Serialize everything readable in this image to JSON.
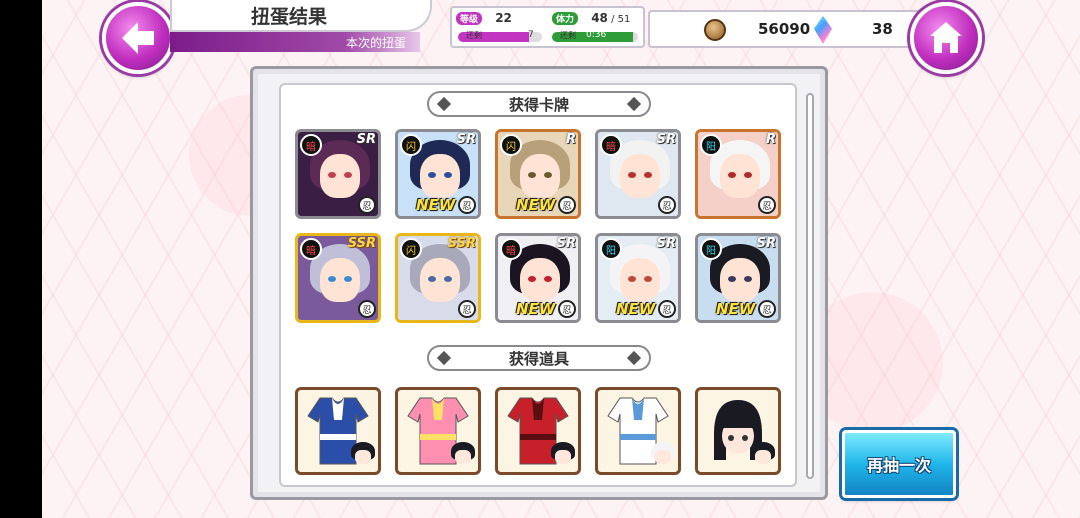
{
  "header": {
    "title": "扭蛋结果",
    "subtitle": "本次的扭蛋",
    "back_icon": "arrow-left-icon",
    "home_icon": "home-icon"
  },
  "status": {
    "level_label": "等级",
    "level_value": "22",
    "level_remain_label": "还剩",
    "level_remain_value": "7",
    "level_progress": 0.85,
    "stamina_label": "体力",
    "stamina_value": "48",
    "stamina_max": "/ 51",
    "stamina_remain_label": "还剩",
    "stamina_remain_value": "0:36",
    "stamina_progress": 0.94,
    "coins": "56090",
    "gems": "38",
    "level_color": "#c235c0",
    "stamina_color": "#2f9c3a"
  },
  "cards_section": {
    "title": "获得卡牌",
    "cards": [
      {
        "rarity": "SR",
        "type": "暗",
        "type_color": "red",
        "new": "",
        "hair": "#5b2a55",
        "eye": "#c04050",
        "bg": "#3a1e44",
        "frame": "#8d8b92"
      },
      {
        "rarity": "SR",
        "type": "闪",
        "type_color": "yellow",
        "new": "NEW",
        "hair": "#1e2a55",
        "eye": "#2c4fa0",
        "bg": "#c8e0f8",
        "frame": "#8d8b92"
      },
      {
        "rarity": "R",
        "type": "闪",
        "type_color": "yellow",
        "new": "NEW",
        "hair": "#b8a07a",
        "eye": "#6a5a30",
        "bg": "#e8d6b8",
        "frame": "#c8742e"
      },
      {
        "rarity": "SR",
        "type": "暗",
        "type_color": "red",
        "new": "",
        "hair": "#f2f2f2",
        "eye": "#b83030",
        "bg": "#dfe8f0",
        "frame": "#8d8b92"
      },
      {
        "rarity": "R",
        "type": "阳",
        "type_color": "cyan",
        "new": "",
        "hair": "#f5f5f5",
        "eye": "#b02a2a",
        "bg": "#f4d0c8",
        "frame": "#c8742e"
      },
      {
        "rarity": "SSR",
        "type": "暗",
        "type_color": "red",
        "new": "",
        "hair": "#bfc0d8",
        "eye": "#3a8ad0",
        "bg": "#7a5a9a",
        "frame": "#e8b81a"
      },
      {
        "rarity": "SSR",
        "type": "闪",
        "type_color": "yellow",
        "new": "",
        "hair": "#a9a9bc",
        "eye": "#4a6aa0",
        "bg": "#d8dcea",
        "frame": "#e8b81a"
      },
      {
        "rarity": "SR",
        "type": "暗",
        "type_color": "red",
        "new": "NEW",
        "hair": "#1a1520",
        "eye": "#c02030",
        "bg": "#f0f0f4",
        "frame": "#8d8b92"
      },
      {
        "rarity": "SR",
        "type": "阳",
        "type_color": "cyan",
        "new": "NEW",
        "hair": "#f4f4f6",
        "eye": "#c04a3a",
        "bg": "#e4ecf4",
        "frame": "#8d8b92"
      },
      {
        "rarity": "SR",
        "type": "阳",
        "type_color": "cyan",
        "new": "NEW",
        "hair": "#1a1a22",
        "eye": "#3a3a5a",
        "bg": "#c8ddf0",
        "frame": "#8d8b92"
      }
    ]
  },
  "items_section": {
    "title": "获得道具",
    "items": [
      {
        "name": "kimono-outfit-icon",
        "main": "#2b4fa8",
        "accent": "#ffffff",
        "chibi_hair": "#1a1a22"
      },
      {
        "name": "swimsuit-outfit-icon",
        "main": "#ff8fb0",
        "accent": "#ffe066",
        "chibi_hair": "#1a1a22"
      },
      {
        "name": "red-suit-outfit-icon",
        "main": "#c8202a",
        "accent": "#5a0e12",
        "chibi_hair": "#1a1a22"
      },
      {
        "name": "sailor-outfit-icon",
        "main": "#ffffff",
        "accent": "#5a9ad8",
        "chibi_hair": "#f4f4f6"
      },
      {
        "name": "chibi-head-icon",
        "main": "#1a1a22",
        "accent": "#ffe7dc",
        "chibi_hair": "#1a1a22"
      }
    ]
  },
  "actions": {
    "retry_label": "再抽一次"
  }
}
